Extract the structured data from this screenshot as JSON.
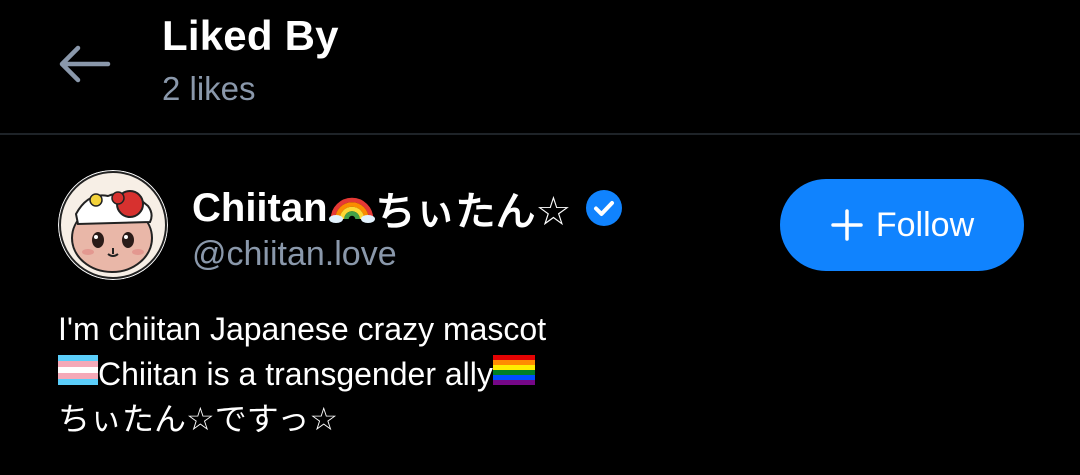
{
  "header": {
    "title": "Liked By",
    "subtitle": "2 likes",
    "back_icon": "arrow-left-icon"
  },
  "user": {
    "name_prefix": "Chiitan",
    "name_suffix": "ちぃたん☆",
    "handle": "@chiitan.love",
    "verified": true,
    "follow_label": "Follow",
    "bio": {
      "line1": "I'm chiitan Japanese crazy mascot",
      "line2_text": "Chiitan is a transgender ally",
      "line3": "ちぃたん☆ですっ☆"
    }
  },
  "colors": {
    "background": "#000000",
    "accent": "#1083fe",
    "muted_text": "#8a98ab",
    "divider": "#1e2328"
  }
}
